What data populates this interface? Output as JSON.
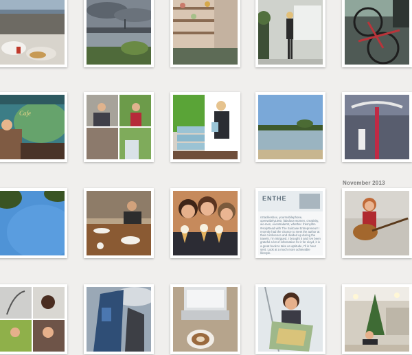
{
  "section_label": "November 2013",
  "photos": [
    {
      "name": "beach-picnic-photo"
    },
    {
      "name": "city-skyline-photo"
    },
    {
      "name": "cafe-interior-photo"
    },
    {
      "name": "presenter-whiteboard-photo"
    },
    {
      "name": "bicycle-in-van-photo"
    },
    {
      "name": "cafe-mural-photo"
    },
    {
      "name": "event-collage-photo"
    },
    {
      "name": "book-stack-photo"
    },
    {
      "name": "lake-shore-photo"
    },
    {
      "name": "bicycle-handlebar-photo"
    },
    {
      "name": "blue-sky-trees-photo"
    },
    {
      "name": "cafe-table-man-photo"
    },
    {
      "name": "ice-cream-friends-photo"
    },
    {
      "name": "magazine-page-photo",
      "heading": "ENTHE",
      "text": "nztacklesbox, yourmobilephone, openwidely1000, fabulous-women, creativity, wo-men, eventsalarmt, whether. frasnylihn #HolyRead with The Suitcase Entrepreneur! I recently had the chance to meet the author at their conference and divided up during the travels. I'm intrigued, I brought it and I've been grateful a lot of information for it for Lloyd, it is a great book to take an aptitude, I'll in hour sent. Look at a much more achievable lifestyle."
    },
    {
      "name": "guitar-player-photo"
    },
    {
      "name": "fern-collage-photo"
    },
    {
      "name": "tall-building-photo"
    },
    {
      "name": "laptop-coffee-photo"
    },
    {
      "name": "woman-with-map-photo"
    },
    {
      "name": "christmas-tree-mall-photo"
    }
  ]
}
